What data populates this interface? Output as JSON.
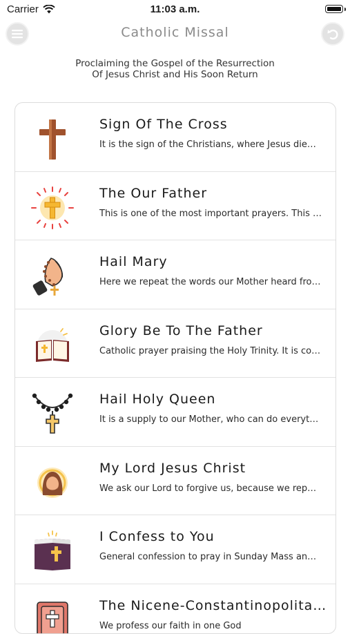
{
  "status": {
    "carrier": "Carrier",
    "time": "11:03 a.m."
  },
  "nav": {
    "title": "Catholic Missal"
  },
  "header": {
    "line1": "Proclaiming the Gospel of the Resurrection",
    "line2": "Of Jesus Christ and His Soon Return"
  },
  "prayers": [
    {
      "title": "Sign Of The Cross",
      "description": "It is the sign of the Christians, where Jesus died for us",
      "icon": "wooden-cross-icon"
    },
    {
      "title": "The Our Father",
      "description": "This is one of the most important prayers. This prayer was taught",
      "icon": "radiant-cross-icon"
    },
    {
      "title": "Hail Mary",
      "description": "Here we repeat the words our Mother heard from the angel",
      "icon": "praying-hands-rosary-icon"
    },
    {
      "title": "Glory Be To The Father",
      "description": "Catholic prayer praising the Holy Trinity. It is commonly prayed",
      "icon": "open-bible-icon"
    },
    {
      "title": "Hail Holy Queen",
      "description": "It is a supply to our Mother, who can do everything for us",
      "icon": "rosary-icon"
    },
    {
      "title": "My Lord Jesus Christ",
      "description": "We ask our Lord to forgive us, because we repent",
      "icon": "jesus-portrait-icon"
    },
    {
      "title": "I Confess to You",
      "description": "General confession to pray in Sunday Mass and other occasions",
      "icon": "holy-book-icon"
    },
    {
      "title": "The Nicene-Constantinopolitan Creed",
      "description": "We profess our faith in one God",
      "icon": "bible-cross-icon"
    }
  ]
}
